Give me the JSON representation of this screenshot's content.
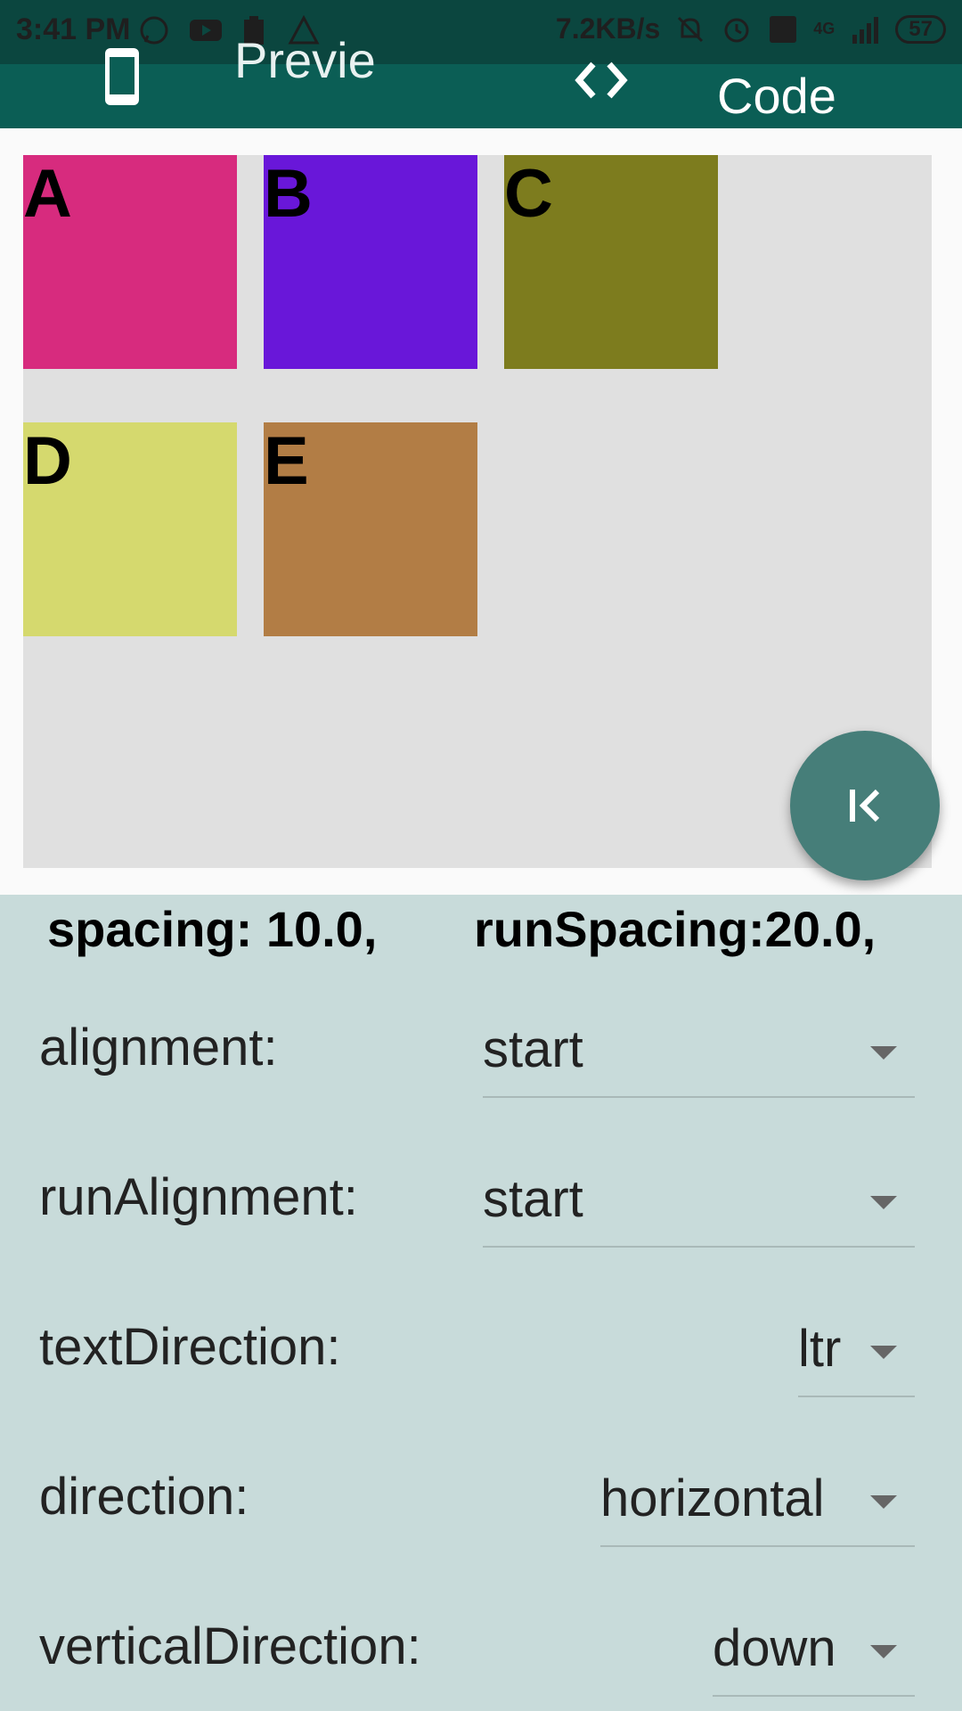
{
  "status_bar": {
    "time": "3:41 PM",
    "network_speed": "7.2KB/s",
    "battery": "57",
    "signal_label": "4G",
    "icons": [
      "whatsapp-icon",
      "youtube-icon",
      "clipboard-icon",
      "warning-icon",
      "mute-icon",
      "alarm-icon",
      "volte-icon",
      "signal-icon",
      "battery-icon"
    ]
  },
  "appbar": {
    "preview_tab": "Preview",
    "code_tab": "Code",
    "colors": {
      "bar": "#0b5e55",
      "status": "#0b463f"
    }
  },
  "preview": {
    "boxes": [
      {
        "label": "A",
        "color": "#d72b7e"
      },
      {
        "label": "B",
        "color": "#6917d9"
      },
      {
        "label": "C",
        "color": "#7d7c1e"
      },
      {
        "label": "D",
        "color": "#d5d96e"
      },
      {
        "label": "E",
        "color": "#b27d45"
      }
    ],
    "fab_icon": "collapse-left-icon",
    "fab_color": "#467e79"
  },
  "controls": {
    "spacing_text": "spacing: 10.0,",
    "run_spacing_text": "runSpacing:20.0,",
    "rows": [
      {
        "label": "alignment:",
        "value": "start"
      },
      {
        "label": "runAlignment:",
        "value": "start"
      },
      {
        "label": "textDirection:",
        "value": "ltr"
      },
      {
        "label": "direction:",
        "value": "horizontal"
      },
      {
        "label": "verticalDirection:",
        "value": "down"
      }
    ]
  }
}
